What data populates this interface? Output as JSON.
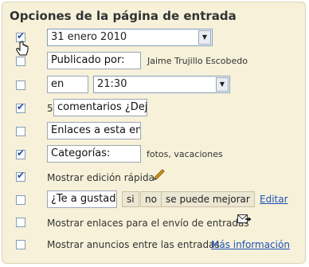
{
  "title": "Opciones de la página de entrada",
  "rows": {
    "date": {
      "checked": true,
      "value": "31 enero 2010"
    },
    "author": {
      "checked": false,
      "input": "Publicado por:",
      "name": "Jaime Trujillo Escobedo"
    },
    "time": {
      "checked": false,
      "prefix": "en",
      "value": "21:30"
    },
    "comments": {
      "checked": true,
      "count": "5",
      "input": "comentarios ¿Deja"
    },
    "backlinks": {
      "checked": false,
      "input": "Enlaces a esta entra"
    },
    "labels": {
      "checked": true,
      "input": "Categorías:",
      "values": "fotos, vacaciones"
    },
    "quickedit": {
      "checked": true,
      "label": "Mostrar edición rápida"
    },
    "reactions": {
      "checked": false,
      "input": "¿Te a gustado",
      "btn_si": "si",
      "btn_no": "no",
      "btn_mejorar": "se puede mejorar",
      "edit_link": "Editar"
    },
    "emailpost": {
      "checked": false,
      "label": "Mostrar enlaces para el envío de entradas"
    },
    "ads": {
      "checked": false,
      "label": "Mostrar anuncios entre las entradas",
      "link": "Más información"
    }
  }
}
